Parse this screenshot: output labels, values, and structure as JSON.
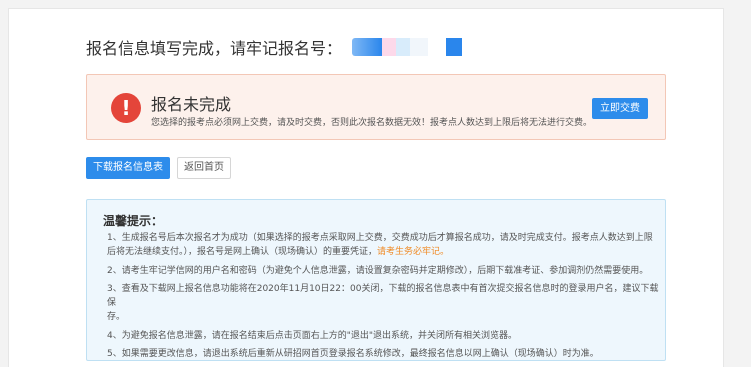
{
  "header": {
    "title": "报名信息填写完成，请牢记报名号："
  },
  "alert": {
    "icon": "exclamation-icon",
    "title": "报名未完成",
    "message": "您选择的报考点必须网上交费，请及时交费，否则此次报名数据无效！报考点人数达到上限后将无法进行交费。",
    "pay_button": "立即交费"
  },
  "actions": {
    "download_label": "下载报名信息表",
    "home_label": "返回首页"
  },
  "tips": {
    "title": "温馨提示：",
    "item1_a": "1、生成报名号后本次报名才为成功（如果选择的报考点采取网上交费，交费成功后才算报名成功，请及时完成支付。报考点人数达到上限",
    "item1_b": "后将无法继续支付。），报名号是网上确认（现场确认）的重要凭证，",
    "item1_highlight": "请考生务必牢记。",
    "item2": "2、请考生牢记学信网的用户名和密码（为避免个人信息泄露，请设置复杂密码并定期修改），后期下载准考证、参加调剂仍然需要使用。",
    "item3_a": "3、查看及下载网上报名信息功能将在2020年11月10日22：00关闭，下载的报名信息表中有首次提交报名信息时的登录用户名，建议下载保",
    "item3_b": "存。",
    "item4": "4、为避免报名信息泄露，请在报名结束后点击页面右上方的\"退出\"退出系统，并关闭所有相关浏览器。",
    "item5": "5、如果需要更改信息，请退出系统后重新从研招网首页登录报名系统修改，最终报名信息以网上确认（现场确认）时为准。"
  },
  "colors": {
    "primary": "#2d8ceb",
    "alert_bg": "#fdf1ec",
    "alert_icon": "#e4453a",
    "tips_bg": "#eef7fd",
    "highlight": "#f08a24"
  }
}
